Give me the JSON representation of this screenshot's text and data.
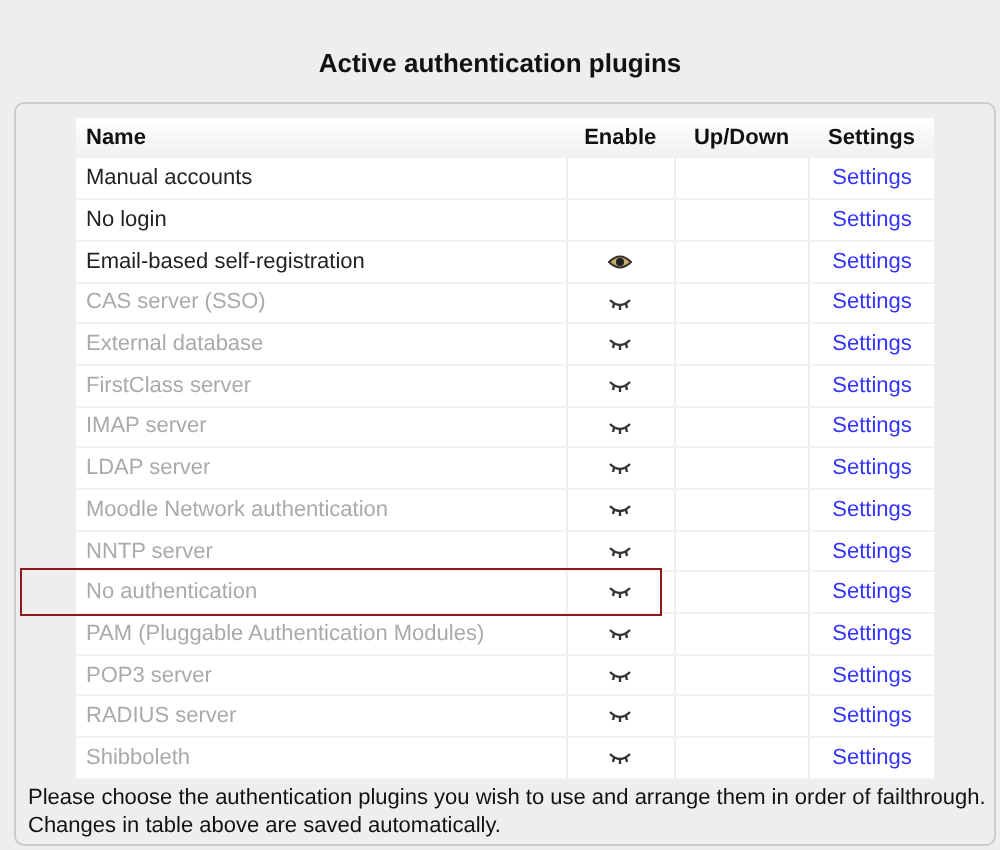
{
  "title": "Active authentication plugins",
  "table": {
    "columns": [
      "Name",
      "Enable",
      "Up/Down",
      "Settings"
    ],
    "rows": [
      {
        "name": "Manual accounts",
        "disabled": false,
        "settings": "Settings",
        "highlighted": false
      },
      {
        "name": "No login",
        "disabled": false,
        "settings": "Settings",
        "highlighted": false
      },
      {
        "name": "Email-based self-registration",
        "disabled": false,
        "enabled": true,
        "settings": "Settings",
        "highlighted": false
      },
      {
        "name": "CAS server (SSO)",
        "disabled": true,
        "enabled": false,
        "settings": "Settings",
        "highlighted": false
      },
      {
        "name": "External database",
        "disabled": true,
        "enabled": false,
        "settings": "Settings",
        "highlighted": false
      },
      {
        "name": "FirstClass server",
        "disabled": true,
        "enabled": false,
        "settings": "Settings",
        "highlighted": false
      },
      {
        "name": "IMAP server",
        "disabled": true,
        "enabled": false,
        "settings": "Settings",
        "highlighted": false
      },
      {
        "name": "LDAP server",
        "disabled": true,
        "enabled": false,
        "settings": "Settings",
        "highlighted": false
      },
      {
        "name": "Moodle Network authentication",
        "disabled": true,
        "enabled": false,
        "settings": "Settings",
        "highlighted": false
      },
      {
        "name": "NNTP server",
        "disabled": true,
        "enabled": false,
        "settings": "Settings",
        "highlighted": false
      },
      {
        "name": "No authentication",
        "disabled": true,
        "enabled": false,
        "settings": "Settings",
        "highlighted": true
      },
      {
        "name": "PAM (Pluggable Authentication Modules)",
        "disabled": true,
        "enabled": false,
        "settings": "Settings",
        "highlighted": false
      },
      {
        "name": "POP3 server",
        "disabled": true,
        "enabled": false,
        "settings": "Settings",
        "highlighted": false
      },
      {
        "name": "RADIUS server",
        "disabled": true,
        "enabled": false,
        "settings": "Settings",
        "highlighted": false
      },
      {
        "name": "Shibboleth",
        "disabled": true,
        "enabled": false,
        "settings": "Settings",
        "highlighted": false
      }
    ]
  },
  "note": [
    "Please choose the authentication plugins you wish to use and arrange them in order of failthrough.",
    "Changes in table above are saved automatically."
  ]
}
